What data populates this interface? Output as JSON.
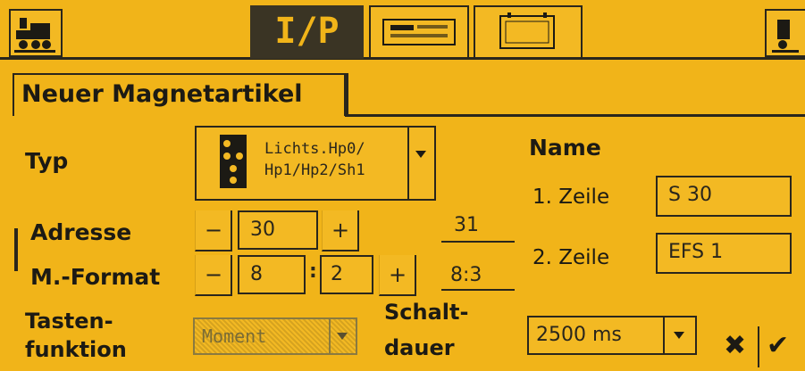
{
  "title": "Neuer Magnetartikel",
  "typ": {
    "label": "Typ",
    "value_line1": "Lichts.Hp0/",
    "value_line2": "Hp1/Hp2/Sh1"
  },
  "name": {
    "label": "Name",
    "row1_label": "1. Zeile",
    "row1_value": "S 30",
    "row2_label": "2. Zeile",
    "row2_value": "EFS 1"
  },
  "adresse": {
    "label": "Adresse",
    "minus": "−",
    "value": "30",
    "plus": "+",
    "result": "31"
  },
  "format": {
    "label": "M.-Format",
    "minus": "−",
    "value1": "8",
    "separator": ":",
    "value2": "2",
    "plus": "+",
    "result": "8:3"
  },
  "tastenfunktion": {
    "label_line1": "Tasten-",
    "label_line2": "funktion",
    "value": "Moment"
  },
  "schaltdauer": {
    "label_line1": "Schalt-",
    "label_line2": "dauer",
    "value": "2500 ms"
  },
  "actions": {
    "cancel": "✖",
    "ok": "✔"
  },
  "toolbar": {
    "center_tab_label": "I/P"
  },
  "colors": {
    "background": "#f1b419",
    "ink": "#1c1a14",
    "dark_tab": "#3a3424"
  }
}
